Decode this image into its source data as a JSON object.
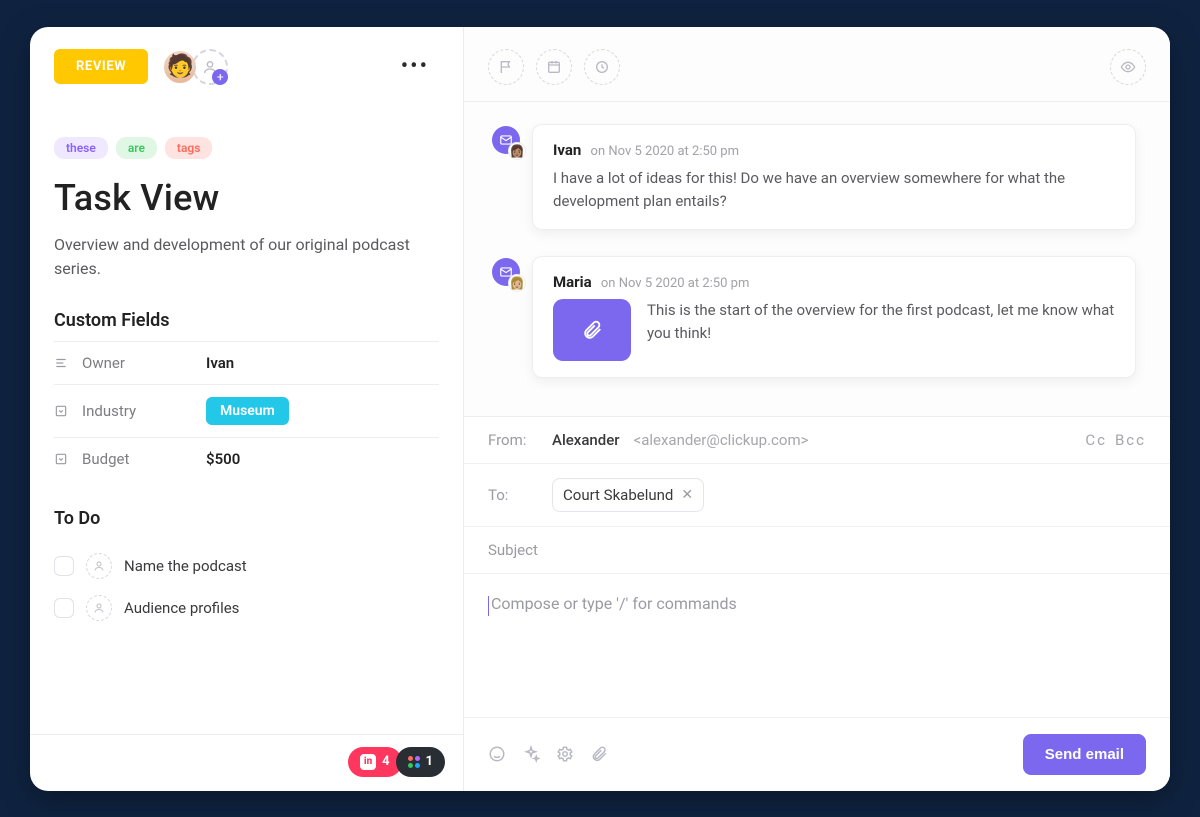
{
  "status": {
    "label": "REVIEW"
  },
  "tags": [
    {
      "text": "these",
      "variant": "purple"
    },
    {
      "text": "are",
      "variant": "green"
    },
    {
      "text": "tags",
      "variant": "red"
    }
  ],
  "task": {
    "title": "Task View",
    "description": "Overview and development of our original podcast series."
  },
  "custom_fields": {
    "heading": "Custom Fields",
    "rows": [
      {
        "icon": "text-icon",
        "label": "Owner",
        "value": "Ivan",
        "type": "text"
      },
      {
        "icon": "dropdown-icon",
        "label": "Industry",
        "value": "Museum",
        "type": "badge"
      },
      {
        "icon": "dropdown-icon",
        "label": "Budget",
        "value": "$500",
        "type": "text"
      }
    ]
  },
  "todo": {
    "heading": "To Do",
    "items": [
      {
        "label": "Name the podcast"
      },
      {
        "label": "Audience profiles"
      }
    ]
  },
  "footer": {
    "pink_count": "4",
    "dark_count": "1"
  },
  "comments": [
    {
      "author": "Ivan",
      "timestamp": "on Nov 5 2020 at 2:50 pm",
      "body": "I have a lot of ideas for this! Do we have an overview somewhere for what the development plan entails?",
      "attachment": false
    },
    {
      "author": "Maria",
      "timestamp": "on Nov 5 2020 at 2:50 pm",
      "body": "This is the start of the overview for the first podcast, let me know what you think!",
      "attachment": true
    }
  ],
  "email": {
    "from_label": "From:",
    "from_name": "Alexander",
    "from_email": "<alexander@clickup.com>",
    "cc": "Cc",
    "bcc": "Bcc",
    "to_label": "To:",
    "to_chip": "Court Skabelund",
    "subject_placeholder": "Subject",
    "body_placeholder": "Compose or type '/' for commands",
    "send_label": "Send email"
  }
}
